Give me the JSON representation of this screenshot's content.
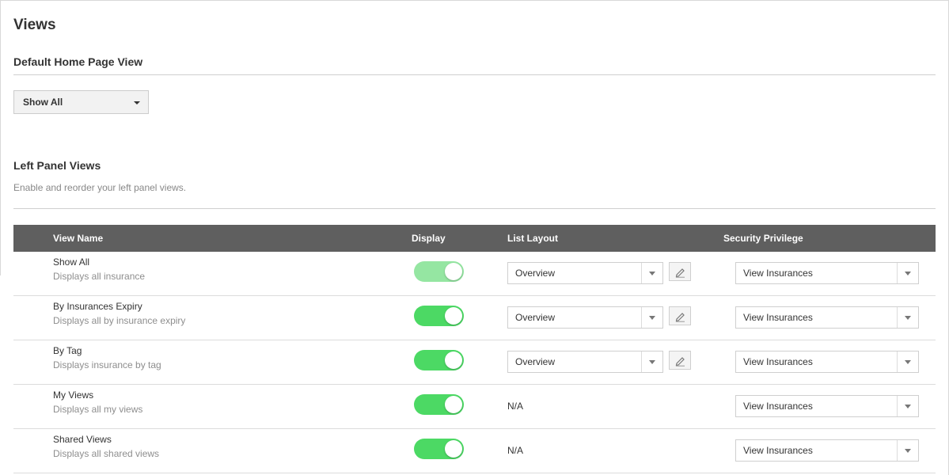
{
  "page": {
    "title": "Views"
  },
  "default_home": {
    "heading": "Default Home Page View",
    "selected": "Show All"
  },
  "left_panel": {
    "heading": "Left Panel Views",
    "subtitle": "Enable and reorder your left panel views."
  },
  "table": {
    "columns": {
      "view_name": "View Name",
      "display": "Display",
      "list_layout": "List Layout",
      "security_privilege": "Security Privilege"
    },
    "rows": [
      {
        "name": "Show All",
        "description": "Displays all insurance",
        "display": true,
        "display_disabled": true,
        "list_layout": "Overview",
        "security": "View Insurances"
      },
      {
        "name": "By Insurances Expiry",
        "description": "Displays all by insurance expiry",
        "display": true,
        "display_disabled": false,
        "list_layout": "Overview",
        "security": "View Insurances"
      },
      {
        "name": "By Tag",
        "description": "Displays insurance by tag",
        "display": true,
        "display_disabled": false,
        "list_layout": "Overview",
        "security": "View Insurances"
      },
      {
        "name": "My Views",
        "description": "Displays all my views",
        "display": true,
        "display_disabled": false,
        "list_layout": "N/A",
        "security": "View Insurances"
      },
      {
        "name": "Shared Views",
        "description": "Displays all shared views",
        "display": true,
        "display_disabled": false,
        "list_layout": "N/A",
        "security": "View Insurances"
      }
    ]
  },
  "colors": {
    "header_bg": "#5f5f5f",
    "toggle_on": "#4cd964",
    "toggle_disabled": "#95e6a2"
  }
}
